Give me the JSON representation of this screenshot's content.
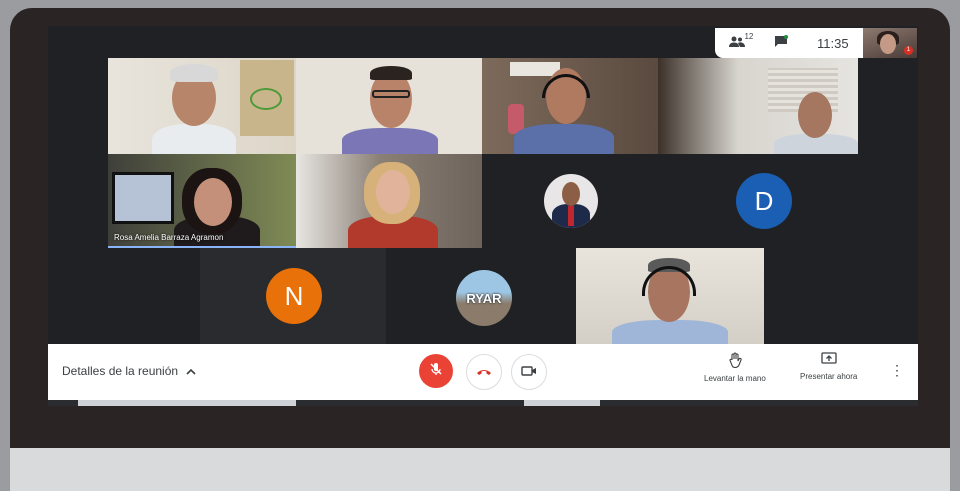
{
  "topbar": {
    "participants_count": "12",
    "time": "11:35",
    "self_badge": "1"
  },
  "tiles": {
    "rosa_name": "Rosa Amelia Barraza Agramon",
    "avatar_d": "D",
    "avatar_n": "N",
    "logo_text": "RYAR"
  },
  "controls": {
    "meeting_details": "Detalles de la reunión",
    "raise_hand": "Levantar la mano",
    "present_now": "Presentar ahora"
  },
  "colors": {
    "accent_blue": "#1a5fb4",
    "avatar_n": "#e8710a",
    "mic_off": "#ea4335",
    "end_call": "#d93025"
  }
}
